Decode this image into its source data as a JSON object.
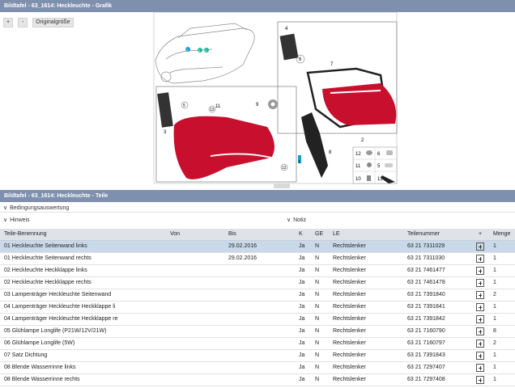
{
  "header": {
    "title": "Bildtafel - 63_1614: Heckleuchte - Grafik"
  },
  "toolbar": {
    "zoom_in": "+",
    "zoom_out": "-",
    "original_size": "Originalgröße"
  },
  "diagram": {
    "callouts": [
      "1",
      "2",
      "3",
      "4",
      "5",
      "6",
      "7",
      "8",
      "9",
      "10",
      "11",
      "12",
      "12",
      "13",
      "5",
      "6",
      "7",
      "1",
      "6",
      "7"
    ]
  },
  "parts_section": {
    "title": "Bildtafel - 63_1614: Heckleuchte - Teile",
    "conditions_label": "Bedingungsauswertung",
    "hint_label": "Hinweis",
    "note_label": "Notiz"
  },
  "table": {
    "headers": [
      "Teile-Benennung",
      "Von",
      "Bis",
      "K",
      "GE",
      "LE",
      "Teilenummer",
      "+",
      "Menge"
    ],
    "rows": [
      [
        "01 Heckleuchte Seitenwand links",
        "",
        "29.02.2016",
        "Ja",
        "N",
        "Rechtslenker",
        "63 21 7311029",
        "",
        "1"
      ],
      [
        "01 Heckleuchte Seitenwand rechts",
        "",
        "29.02.2016",
        "Ja",
        "N",
        "Rechtslenker",
        "63 21 7311030",
        "",
        "1"
      ],
      [
        "02 Heckleuchte Heckklappe links",
        "",
        "",
        "Ja",
        "N",
        "Rechtslenker",
        "63 21 7461477",
        "",
        "1"
      ],
      [
        "02 Heckleuchte Heckklappe rechts",
        "",
        "",
        "Ja",
        "N",
        "Rechtslenker",
        "63 21 7461478",
        "",
        "1"
      ],
      [
        "03 Lampenträger Heckleuchte Seitenwand",
        "",
        "",
        "Ja",
        "N",
        "Rechtslenker",
        "63 21 7391840",
        "",
        "2"
      ],
      [
        "04 Lampenträger Heckleuchte Heckklappe li",
        "",
        "",
        "Ja",
        "N",
        "Rechtslenker",
        "63 21 7391841",
        "",
        "1"
      ],
      [
        "04 Lampenträger Heckleuchte Heckklappe re",
        "",
        "",
        "Ja",
        "N",
        "Rechtslenker",
        "63 21 7391842",
        "",
        "1"
      ],
      [
        "05 Glühlampe Longlife (P21W/12V/21W)",
        "",
        "",
        "Ja",
        "N",
        "Rechtslenker",
        "63 21 7160790",
        "",
        "8"
      ],
      [
        "06 Glühlampe Longlife (5W)",
        "",
        "",
        "Ja",
        "N",
        "Rechtslenker",
        "63 21 7160797",
        "",
        "2"
      ],
      [
        "07 Satz Dichtung",
        "",
        "",
        "Ja",
        "N",
        "Rechtslenker",
        "63 21 7391843",
        "",
        "1"
      ],
      [
        "08 Blende Wasserrinne links",
        "",
        "",
        "Ja",
        "N",
        "Rechtslenker",
        "63 21 7297407",
        "",
        "1"
      ],
      [
        "08 Blende Wasserrinne rechts",
        "",
        "",
        "Ja",
        "N",
        "Rechtslenker",
        "63 21 7297408",
        "",
        "1"
      ]
    ]
  }
}
